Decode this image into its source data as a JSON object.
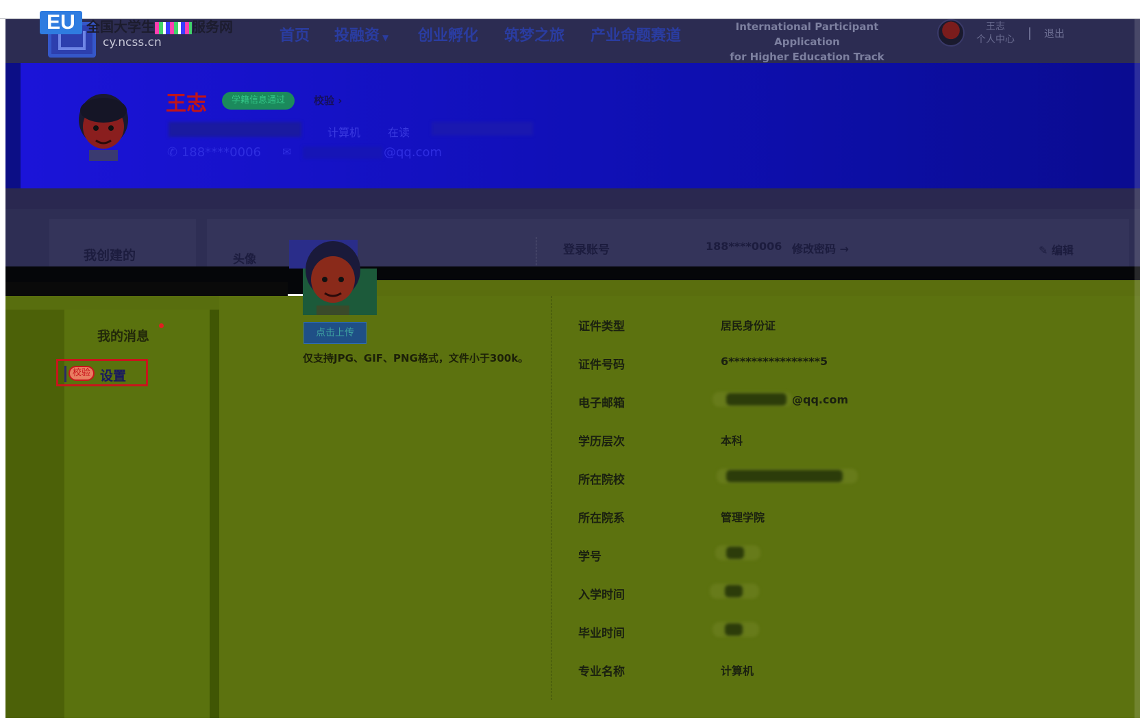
{
  "header": {
    "site_title_prefix": "全国大学生",
    "site_title_suffix": "服务网",
    "site_domain": "cy.ncss.cn",
    "logo_text": "EU",
    "nav": [
      "首页",
      "投融资",
      "创业孵化",
      "筑梦之旅",
      "产业命题赛道"
    ],
    "intl_line1": "International Participant Application",
    "intl_line2": "for Higher Education Track",
    "user_name": "王志",
    "user_center": "个人中心",
    "logout": "退出"
  },
  "profile": {
    "name": "王志",
    "verified_badge": "学籍信息通过",
    "verify_link": "校验",
    "major": "计算机",
    "status": "在读",
    "phone": "188****0006",
    "email_suffix": "@qq.com"
  },
  "sidebar": {
    "title": "我创建的",
    "messages": "我的消息",
    "settings_badge": "校验",
    "settings": "设置"
  },
  "account": {
    "avatar_label": "头像",
    "login_label": "登录账号",
    "login_value": "188****0006",
    "change_password": "修改密码 →",
    "edit": "编辑",
    "upload_button": "点击上传",
    "upload_note": "仅支持JPG、GIF、PNG格式，文件小于300k。"
  },
  "fields": [
    {
      "label": "证件类型",
      "value": "居民身份证"
    },
    {
      "label": "证件号码",
      "value": "6****************5"
    },
    {
      "label": "电子邮箱",
      "value": "@qq.com"
    },
    {
      "label": "学历层次",
      "value": "本科"
    },
    {
      "label": "所在院校",
      "value": ""
    },
    {
      "label": "所在院系",
      "value": "管理学院"
    },
    {
      "label": "学号",
      "value": ""
    },
    {
      "label": "入学时间",
      "value": ""
    },
    {
      "label": "毕业时间",
      "value": ""
    },
    {
      "label": "专业名称",
      "value": "计算机"
    }
  ],
  "colors": {
    "banner": "#1b14d8",
    "accent_red": "#c8151c",
    "green_area": "#586e0e",
    "header_bg": "#2c2c52"
  }
}
